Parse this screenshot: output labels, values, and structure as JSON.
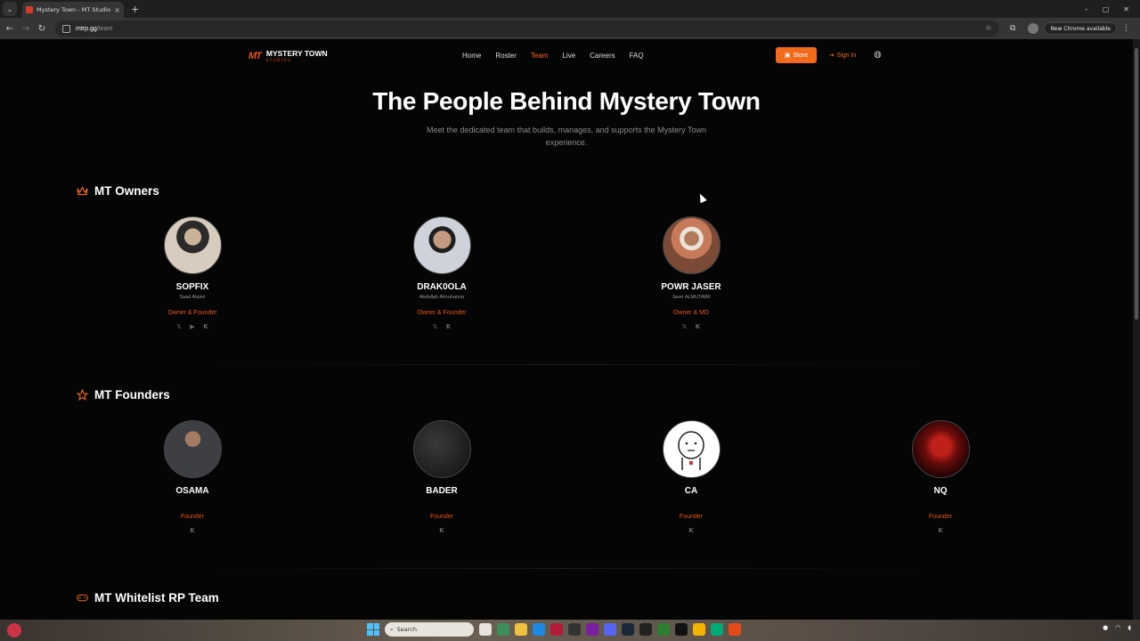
{
  "browser": {
    "tab_title": "Mystery Town - MT Studios | M",
    "url_host": "mtrp.gg",
    "url_path": "/team",
    "update_label": "New Chrome available",
    "tab_close": "×",
    "new_tab": "+",
    "back": "←",
    "forward": "→",
    "reload": "↻",
    "star": "☆",
    "kebab": "⋮",
    "min": "–",
    "max": "▢",
    "close": "✕"
  },
  "site": {
    "logo_mark": "MT",
    "logo_name": "MYSTERY TOWN",
    "logo_sub": "STUDIOS",
    "nav": [
      {
        "label": "Home"
      },
      {
        "label": "Roster"
      },
      {
        "label": "Team"
      },
      {
        "label": "Live"
      },
      {
        "label": "Careers"
      },
      {
        "label": "FAQ"
      }
    ],
    "active_nav": "Team",
    "store_label": "Store",
    "signin_label": "Sign In",
    "accent_color": "#f26a1b"
  },
  "hero": {
    "title": "The People Behind Mystery Town",
    "subtitle": "Meet the dedicated team that builds, manages, and supports the Mystery Town experience."
  },
  "sections": {
    "owners": {
      "title": "MT Owners",
      "icon": "crown-icon",
      "members": [
        {
          "name": "SOPFIX",
          "real_name": "Saad Alasiri",
          "role": "Owner & Founder",
          "socials": [
            "𝕏",
            "▶",
            "K"
          ]
        },
        {
          "name": "DRAK0OLA",
          "real_name": "Abdullah Almuhanna",
          "role": "Owner & Founder",
          "socials": [
            "𝕏",
            "K"
          ]
        },
        {
          "name": "POWR JASER",
          "real_name": "Jaser ALMUTAIRI",
          "role": "Owner & MD",
          "socials": [
            "𝕏",
            "K"
          ]
        }
      ]
    },
    "founders": {
      "title": "MT Founders",
      "icon": "star-icon",
      "members": [
        {
          "name": "OSAMA",
          "role": "Founder",
          "socials": [
            "K"
          ]
        },
        {
          "name": "BADER",
          "role": "Founder",
          "socials": [
            "K"
          ]
        },
        {
          "name": "CA",
          "role": "Founder",
          "socials": [
            "K"
          ]
        },
        {
          "name": "NQ",
          "role": "Founder",
          "socials": [
            "K"
          ]
        }
      ]
    },
    "whitelist": {
      "title": "MT Whitelist RP Team",
      "icon": "gamepad-icon"
    }
  },
  "taskbar": {
    "search_label": "Search"
  }
}
